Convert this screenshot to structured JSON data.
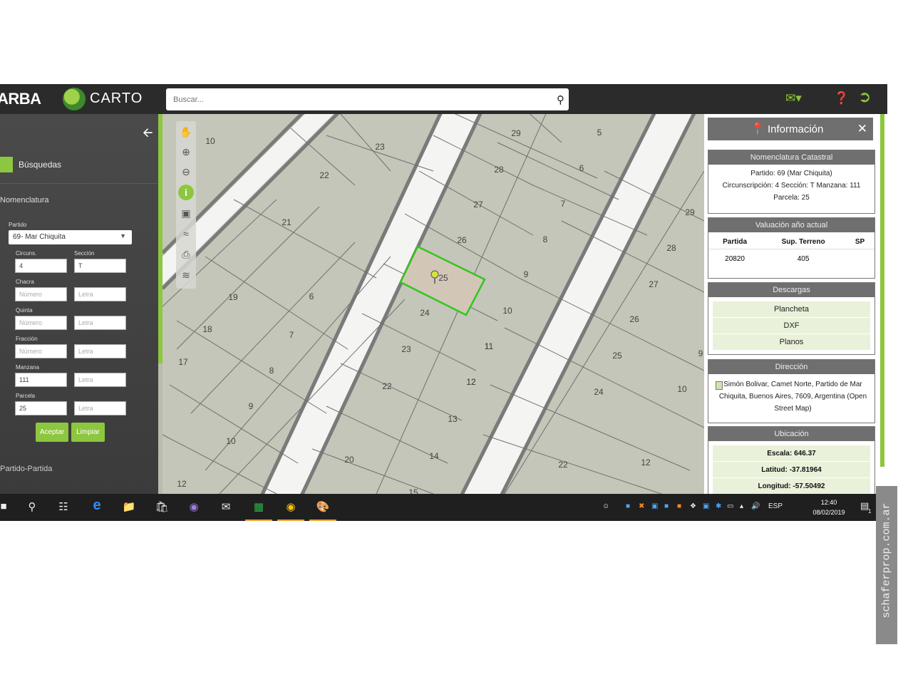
{
  "header": {
    "logo_arba": "ARBA",
    "logo_carto": "CARTO",
    "search_placeholder": "Buscar...",
    "icons": [
      "mail-icon",
      "help-icon",
      "logout-icon"
    ]
  },
  "sidebar": {
    "busquedas_label": "Búsquedas",
    "nomenclatura_title": "Nomenclatura",
    "partido_label": "Partido",
    "partido_value": "69- Mar Chiquita",
    "fields": [
      {
        "label": "Circuns.",
        "value": "4"
      },
      {
        "label": "Sección",
        "value": "T"
      },
      {
        "label": "Chacra",
        "value": "Número"
      },
      {
        "label": "Quinta",
        "value": "Número"
      },
      {
        "label": "Fracción",
        "value": "Número"
      },
      {
        "label": "Manzana",
        "value": "111"
      },
      {
        "label": "Parcela",
        "value": "25"
      }
    ],
    "letra_placeholder": "Letra",
    "aceptar": "Aceptar",
    "limpiar": "Limpiar",
    "partido_partida": "Partido-Partida"
  },
  "map": {
    "parcels_left": [
      "10",
      "23",
      "22",
      "21",
      "19",
      "6",
      "18",
      "7",
      "17",
      "8",
      "9",
      "10",
      "12"
    ],
    "parcels_mid": [
      "29",
      "28",
      "27",
      "26",
      "25",
      "24",
      "23",
      "22",
      "20",
      "11",
      "12",
      "13",
      "14",
      "15"
    ],
    "parcels_right": [
      "5",
      "6",
      "7",
      "8",
      "9",
      "10",
      "11",
      "12",
      "29",
      "28",
      "27",
      "26",
      "25",
      "24",
      "22",
      "12",
      "10",
      "9"
    ]
  },
  "panel": {
    "title": "Información",
    "nomenclatura": {
      "heading": "Nomenclatura Catastral",
      "line1": "Partido: 69 (Mar Chiquita)",
      "line2": "Circunscripción: 4 Sección: T Manzana: 111",
      "line3": "Parcela: 25"
    },
    "valuacion": {
      "heading": "Valuación año actual",
      "headers": [
        "Partida",
        "Sup. Terreno",
        "SP"
      ],
      "row": [
        "20820",
        "405",
        ""
      ]
    },
    "descargas": {
      "heading": "Descargas",
      "items": [
        "Plancheta",
        "DXF",
        "Planos"
      ]
    },
    "direccion": {
      "heading": "Dirección",
      "text": "Simón Bolivar, Camet Norte, Partido de Mar Chiquita, Buenos Aires, 7609, Argentina (Open Street Map)"
    },
    "ubicacion": {
      "heading": "Ubicación",
      "escala_label": "Escala:",
      "escala_value": "646.37",
      "latitud_label": "Latitud:",
      "latitud_value": "-37.81964",
      "longitud_label": "Longitud:",
      "longitud_value": "-57.50492"
    }
  },
  "taskbar": {
    "lang": "ESP",
    "time": "12:40",
    "date": "08/02/2019",
    "notif_count": "1"
  },
  "watermark": "schaferprop.com.ar",
  "colors": {
    "accent": "#8dc63f",
    "header": "#2b2b2b",
    "selected_parcel": "#34c51f"
  }
}
